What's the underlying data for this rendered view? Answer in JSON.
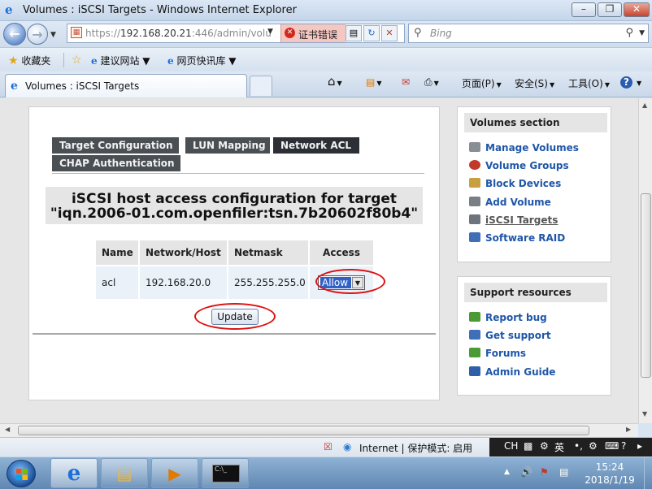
{
  "window": {
    "title": "Volumes : iSCSI Targets - Windows Internet Explorer",
    "minimize": "–",
    "restore": "❐",
    "close": "✕"
  },
  "addressbar": {
    "url_prefix": "https://",
    "url_host": "192.168.20.21",
    "url_rest": ":446/admin/volu",
    "cert_error": "证书错误",
    "search_placeholder": "Bing"
  },
  "favorites": {
    "favorites_label": "收藏夹",
    "suggested_sites": "建议网站 ▼",
    "web_slices": "网页快讯库 ▼"
  },
  "tabbar": {
    "tab_title": "Volumes : iSCSI Targets",
    "page_menu": "页面(P)",
    "safety_menu": "安全(S)",
    "tools_menu": "工具(O)"
  },
  "main": {
    "tabs": [
      {
        "label": "Target Configuration"
      },
      {
        "label": "LUN Mapping"
      },
      {
        "label": "Network ACL"
      },
      {
        "label": "CHAP Authentication"
      }
    ],
    "heading_line1": "iSCSI host access configuration for target",
    "heading_line2": "\"iqn.2006-01.com.openfiler:tsn.7b20602f80b4\"",
    "table": {
      "headers": [
        "Name",
        "Network/Host",
        "Netmask",
        "Access"
      ],
      "row": {
        "name": "acl",
        "network": "192.168.20.0",
        "netmask": "255.255.255.0",
        "access": "Allow"
      }
    },
    "update_button": "Update"
  },
  "sidebar": {
    "volumes_section": {
      "title": "Volumes section",
      "items": [
        {
          "label": "Manage Volumes",
          "icon": "manage-volumes-icon",
          "color": "#8a8f96"
        },
        {
          "label": "Volume Groups",
          "icon": "volume-groups-icon",
          "color": "#c0392b"
        },
        {
          "label": "Block Devices",
          "icon": "block-devices-icon",
          "color": "#c8a040"
        },
        {
          "label": "Add Volume",
          "icon": "add-volume-icon",
          "color": "#7a7f86"
        },
        {
          "label": "iSCSI Targets",
          "icon": "iscsi-targets-icon",
          "color": "#6e747b"
        },
        {
          "label": "Software RAID",
          "icon": "software-raid-icon",
          "color": "#3f6fb6"
        }
      ]
    },
    "support_section": {
      "title": "Support resources",
      "items": [
        {
          "label": "Report bug",
          "icon": "report-bug-icon",
          "color": "#4a9a35"
        },
        {
          "label": "Get support",
          "icon": "get-support-icon",
          "color": "#3f6fb6"
        },
        {
          "label": "Forums",
          "icon": "forums-icon",
          "color": "#4a9a35"
        },
        {
          "label": "Admin Guide",
          "icon": "admin-guide-icon",
          "color": "#2f5fa8"
        }
      ]
    }
  },
  "statusbar": {
    "zone": "Internet | 保护模式: 启用",
    "ime_lang": "CH",
    "ime_mode": "英"
  },
  "taskbar": {
    "time": "15:24",
    "date": "2018/1/19"
  },
  "colors": {
    "link": "#1f56a8",
    "tab_bg": "#4a4f54",
    "tab_active": "#2c3036",
    "highlight_ellipse": "#dd1111",
    "select_value_bg": "#3161c5"
  }
}
